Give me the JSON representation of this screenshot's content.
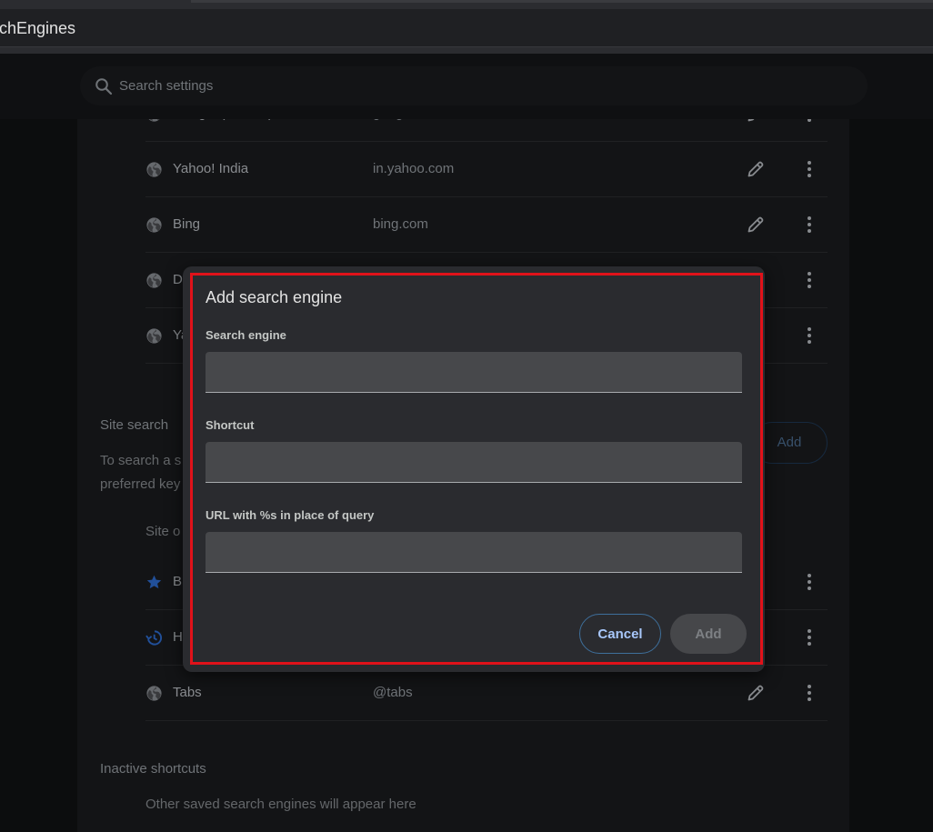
{
  "browser": {
    "url_fragment": "chEngines"
  },
  "search": {
    "placeholder": "Search settings"
  },
  "engines": [
    {
      "name": "Google (Default)",
      "keyword": "google.com"
    },
    {
      "name": "Yahoo! India",
      "keyword": "in.yahoo.com"
    },
    {
      "name": "Bing",
      "keyword": "bing.com"
    },
    {
      "name": "D",
      "keyword": ""
    },
    {
      "name": "Ya",
      "keyword": ""
    }
  ],
  "site_search": {
    "title": "Site search",
    "desc_line1": "To search a s",
    "desc_line2": "preferred key",
    "add_label": "Add",
    "column_header": "Site o",
    "items": [
      {
        "name": "B",
        "keyword": "",
        "icon": "star-icon"
      },
      {
        "name": "H",
        "keyword": "",
        "icon": "history-icon"
      },
      {
        "name": "Tabs",
        "keyword": "@tabs",
        "icon": "globe-icon"
      }
    ]
  },
  "inactive": {
    "title": "Inactive shortcuts",
    "desc": "Other saved search engines will appear here"
  },
  "dialog": {
    "title": "Add search engine",
    "fields": [
      {
        "label": "Search engine",
        "value": ""
      },
      {
        "label": "Shortcut",
        "value": ""
      },
      {
        "label": "URL with %s in place of query",
        "value": ""
      }
    ],
    "cancel_label": "Cancel",
    "add_label": "Add"
  },
  "colors": {
    "highlight": "#e0121a",
    "accent": "#a8c7fa",
    "dialog_bg": "#2a2b2f"
  }
}
